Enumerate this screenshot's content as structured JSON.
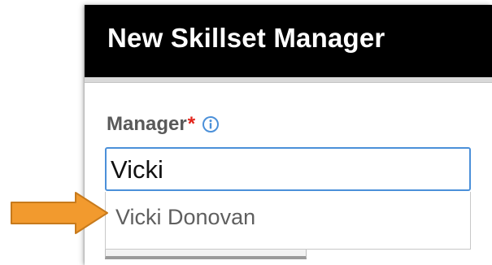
{
  "dialog": {
    "title": "New Skillset Manager"
  },
  "form": {
    "manager_field": {
      "label": "Manager",
      "required_mark": "*",
      "value": "Vicki"
    },
    "suggestions": [
      {
        "label": "Vicki Donovan"
      }
    ]
  },
  "icons": {
    "info": "info-circle-icon",
    "arrow": "right-arrow-icon"
  },
  "colors": {
    "header_background": "#000000",
    "header_text": "#ffffff",
    "required": "#e2231a",
    "focus_border": "#4b90d9",
    "info_icon": "#4b90d9",
    "arrow_fill": "#f29a2e",
    "arrow_outline": "#c77a1c"
  }
}
